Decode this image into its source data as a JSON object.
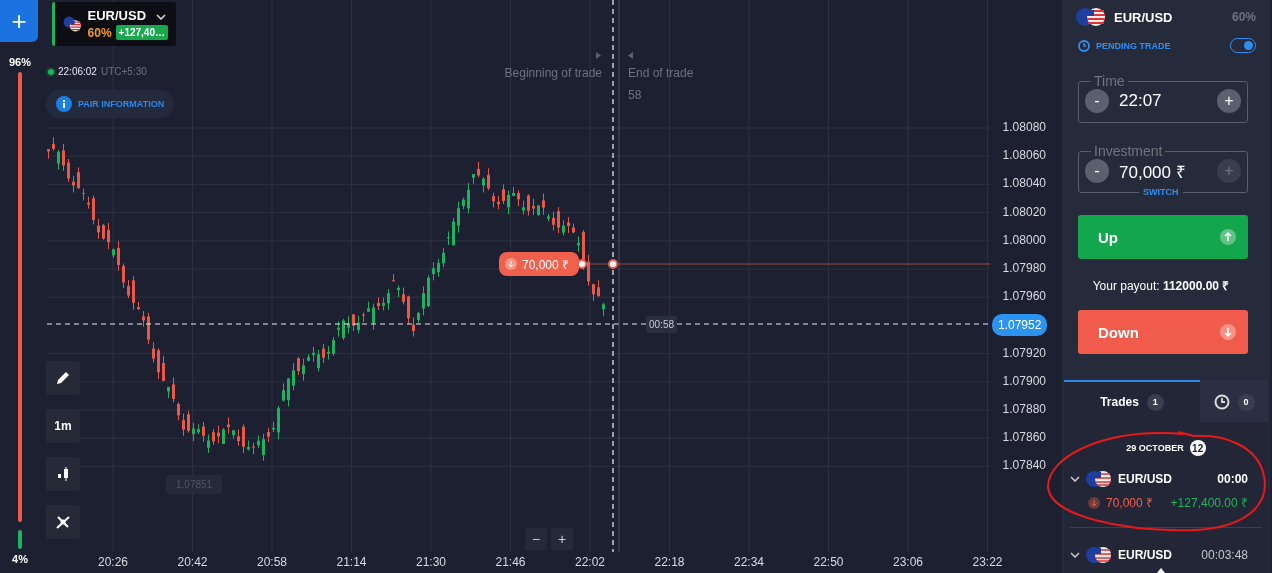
{
  "left_rail": {
    "add_button": "+",
    "sentiment": {
      "up_label": "96%",
      "down_label": "4%",
      "level": 0.96
    }
  },
  "asset_card": {
    "pair": "EUR/USD",
    "payout": "60%",
    "profit": "+127,40…"
  },
  "clock": {
    "time": "22:06:02",
    "zone": "UTC+5:30"
  },
  "pair_info_button": "PAIR INFORMATION",
  "chart": {
    "start_label": "Beginning of trade",
    "end_label": "End of trade",
    "countdown": "58",
    "y_ticks": [
      "1.08080",
      "1.08060",
      "1.08040",
      "1.08020",
      "1.08000",
      "1.07980",
      "1.07960",
      "1.07920",
      "1.07900",
      "1.07880",
      "1.07860",
      "1.07840"
    ],
    "x_ticks": [
      "20:26",
      "20:42",
      "20:58",
      "21:14",
      "21:30",
      "21:46",
      "22:02",
      "22:18",
      "22:34",
      "22:50",
      "23:06",
      "23:22"
    ],
    "current_price": "1.07952",
    "timer": "00:58",
    "low_label": "1.07851",
    "open_trade": {
      "amount": "70,000 ₹"
    },
    "tools": [
      {
        "kind": "draw"
      },
      {
        "kind": "timeframe",
        "label": "1m"
      },
      {
        "kind": "chart_type"
      },
      {
        "kind": "indicators"
      }
    ],
    "zoom_buttons": [
      "−",
      "+"
    ]
  },
  "panel": {
    "pair": "EUR/USD",
    "payout": "60%",
    "pending": {
      "label": "PENDING TRADE",
      "on": true
    },
    "time": {
      "label": "Time",
      "value": "22:07",
      "minus": "-",
      "plus": "+",
      "plus_disabled": false
    },
    "investment": {
      "label": "Investment",
      "value": "70,000 ₹",
      "minus": "-",
      "plus": "+",
      "plus_disabled": true,
      "switch": "SWITCH"
    },
    "up_button": "Up",
    "payout_text": "Your payout: **112000.00 ₹**",
    "down_button": "Down"
  },
  "tabs": [
    {
      "kind": "text",
      "label": "Trades",
      "count": "1",
      "selected": true
    },
    {
      "kind": "clock",
      "count": "0",
      "selected": false
    }
  ],
  "trades": {
    "date": "29 OCTOBER",
    "date_count": "12",
    "items": [
      {
        "pair": "EUR/USD",
        "time": "00:00",
        "amount": "70,000 ₹",
        "profit": "+127,400.00 ₹"
      },
      {
        "pair": "EUR/USD",
        "time": "00:03:48"
      }
    ]
  }
}
